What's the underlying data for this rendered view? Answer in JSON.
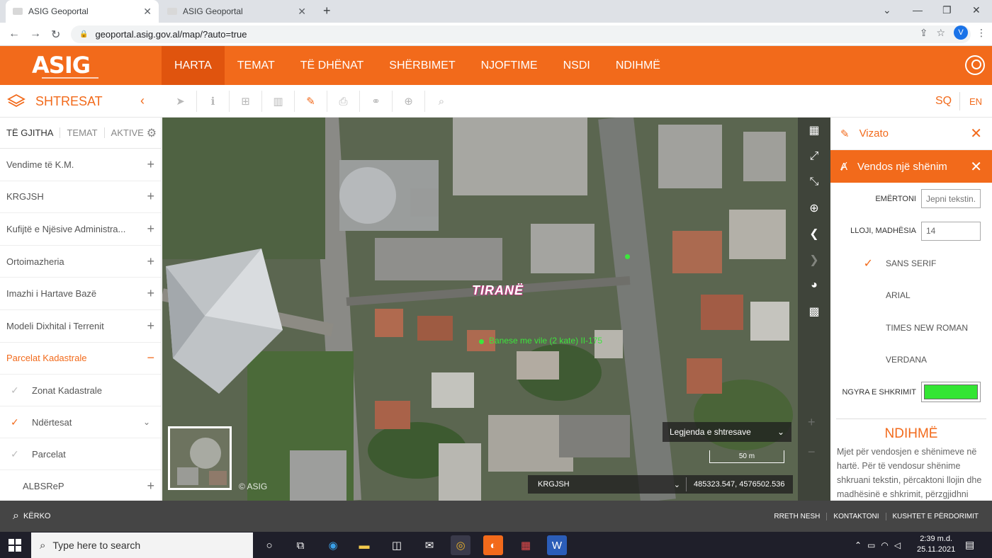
{
  "browser": {
    "tabs": [
      {
        "title": "ASIG Geoportal",
        "active": true
      },
      {
        "title": "ASIG Geoportal",
        "active": false
      }
    ],
    "url": "geoportal.asig.gov.al/map/?auto=true",
    "profile_initial": "V"
  },
  "header": {
    "logo_text": "ASIG",
    "nav": [
      "HARTA",
      "TEMAT",
      "TË DHËNAT",
      "SHËRBIMET",
      "NJOFTIME",
      "NSDI",
      "NDIHMË"
    ],
    "active_nav": "HARTA"
  },
  "toolbar": {
    "layers_title": "SHTRESAT",
    "languages": {
      "sq": "SQ",
      "en": "EN"
    }
  },
  "sidebar": {
    "tabs": [
      "TË GJITHA",
      "TEMAT",
      "AKTIVE"
    ],
    "items": [
      "Vendime të K.M.",
      "KRGJSH",
      "Kufijtë e Njësive Administra...",
      "Ortoimazheria",
      "Imazhi i Hartave Bazë",
      "Modeli Dixhital i Terrenit"
    ],
    "open_item": "Parcelat Kadastrale",
    "sub_items": [
      {
        "label": "Zonat Kadastrale",
        "checked": false
      },
      {
        "label": "Ndërtesat",
        "checked": true
      },
      {
        "label": "Parcelat",
        "checked": false
      }
    ],
    "last_item": "ALBSReP"
  },
  "map": {
    "city_label": "TIRANË",
    "poi_label": "Banese me vile (2 kate)   II-175",
    "copyright": "© ASIG",
    "legend_label": "Legjenda e shtresave",
    "scale_label": "50 m",
    "crs_selected": "KRGJSH",
    "coordinates": "485323.547, 4576502.536"
  },
  "draw_panel": {
    "title": "Vizato",
    "subtitle": "Vendos një shënim",
    "label_field": {
      "label": "EMËRTONI",
      "placeholder": "Jepni tekstin..."
    },
    "size_field": {
      "label": "LLOJI, MADHËSIA",
      "value": "14"
    },
    "fonts": [
      {
        "name": "SANS SERIF",
        "selected": true
      },
      {
        "name": "ARIAL",
        "selected": false
      },
      {
        "name": "TIMES NEW ROMAN",
        "selected": false
      },
      {
        "name": "VERDANA",
        "selected": false
      }
    ],
    "color_label": "NGYRA E SHKRIMIT",
    "color_value": "#33e533",
    "help_title": "NDIHMË",
    "help_text": "Mjet për vendosjen e shënimeve në hartë. Për të vendosur shënime shkruani tekstin, përcaktoni llojin dhe madhësinë e shkrimit, përzgjidhni"
  },
  "footer": {
    "search_label": "KËRKO",
    "links": [
      "RRETH NESH",
      "KONTAKTONI",
      "KUSHTET E PËRDORIMIT"
    ]
  },
  "taskbar": {
    "search_placeholder": "Type here to search",
    "time": "2:39 m.d.",
    "date": "25.11.2021"
  },
  "colors": {
    "brand": "#f26a1b",
    "footer": "#454545"
  }
}
